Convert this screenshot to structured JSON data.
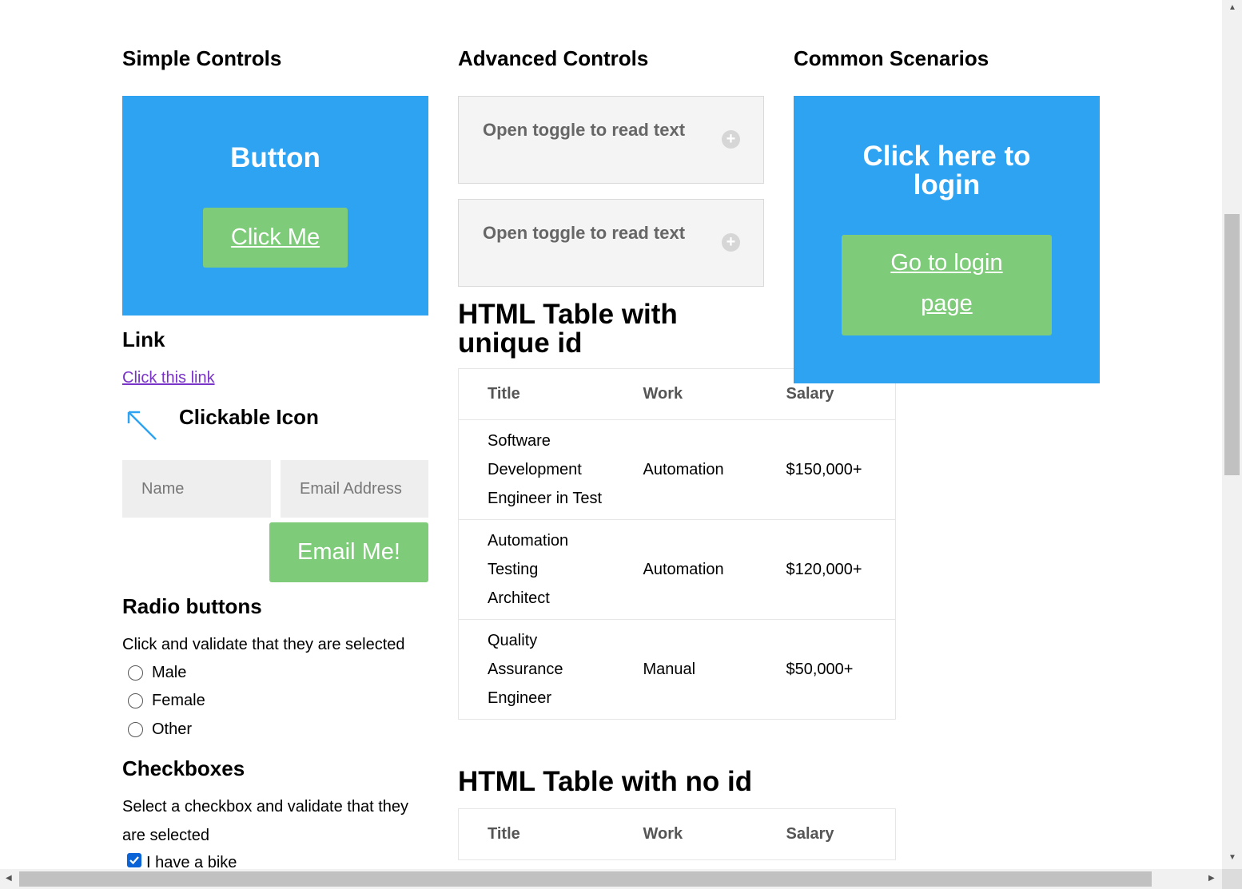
{
  "simple": {
    "heading": "Simple Controls",
    "button_box_title": "Button",
    "click_me": "Click Me",
    "link_heading": "Link",
    "link_text": "Click this link",
    "icon_heading": "Clickable Icon",
    "name_placeholder": "Name",
    "email_placeholder": "Email Address",
    "email_button": "Email Me!",
    "radio_heading": "Radio buttons",
    "radio_desc": "Click and validate that they are selected",
    "radios": [
      "Male",
      "Female",
      "Other"
    ],
    "checkbox_heading": "Checkboxes",
    "checkbox_desc": "Select a checkbox and validate that they are selected",
    "checkbox_item": "I have a bike"
  },
  "advanced": {
    "heading": "Advanced Controls",
    "toggles": [
      "Open toggle to read text",
      "Open toggle to read text"
    ],
    "table1_heading": "HTML Table with unique id",
    "table_headers": [
      "Title",
      "Work",
      "Salary"
    ],
    "table1_rows": [
      [
        "Software Development Engineer in Test",
        "Automation",
        "$150,000+"
      ],
      [
        "Automation Testing Architect",
        "Automation",
        "$120,000+"
      ],
      [
        "Quality Assurance Engineer",
        "Manual",
        "$50,000+"
      ]
    ],
    "table2_heading": "HTML Table with no id"
  },
  "common": {
    "heading": "Common Scenarios",
    "login_title": "Click here to login",
    "login_button": "Go to login page"
  },
  "colors": {
    "blue": "#2ea3f2",
    "green": "#7ecb79",
    "link": "#7a34c8"
  }
}
